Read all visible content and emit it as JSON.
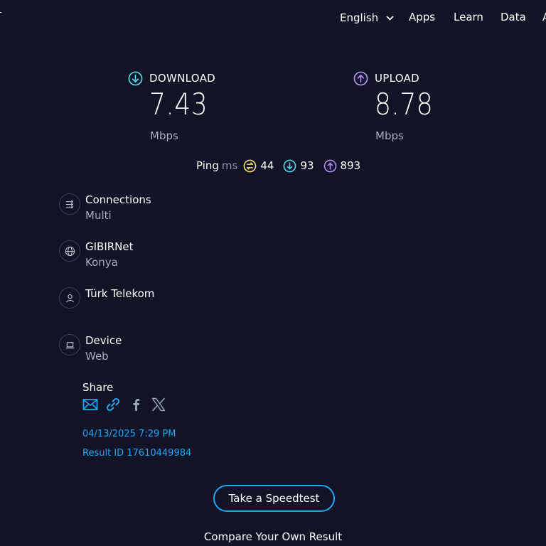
{
  "nav": {
    "language": "English",
    "apps": "Apps",
    "learn": "Learn",
    "data": "Data",
    "cut_item": "A"
  },
  "download": {
    "label": "DOWNLOAD",
    "value": "7.43",
    "unit": "Mbps"
  },
  "upload": {
    "label": "UPLOAD",
    "value": "8.78",
    "unit": "Mbps"
  },
  "ping": {
    "label": "Ping",
    "unit": "ms",
    "idle": "44",
    "download": "93",
    "upload": "893"
  },
  "info": {
    "connections": {
      "title": "Connections",
      "value": "Multi"
    },
    "server": {
      "title": "GIBIRNet",
      "value": "Konya"
    },
    "provider": {
      "title": "Türk Telekom"
    },
    "device": {
      "title": "Device",
      "value": "Web"
    }
  },
  "share": {
    "title": "Share"
  },
  "result": {
    "date": "04/13/2025 7:29 PM",
    "id_label": "Result ID 17610449984"
  },
  "cta": {
    "label": "Take a Speedtest"
  },
  "compare": {
    "label": "Compare Your Own Result"
  },
  "colors": {
    "accent_blue": "#1fa7f5",
    "download_teal": "#4fd6e6",
    "upload_purple": "#b58cf2",
    "ping_yellow": "#f3dc6a",
    "background": "#111326"
  }
}
